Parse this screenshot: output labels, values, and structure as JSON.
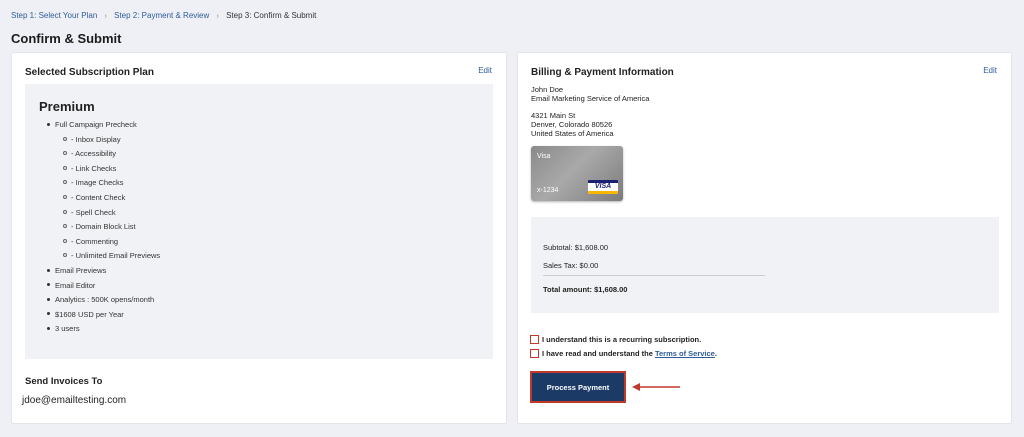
{
  "breadcrumb": {
    "steps": [
      "Step 1: Select Your Plan",
      "Step 2: Payment & Review",
      "Step 3: Confirm & Submit"
    ],
    "separator": "›"
  },
  "page_title": "Confirm & Submit",
  "subscription": {
    "title": "Selected Subscription Plan",
    "edit_label": "Edit",
    "plan_name": "Premium",
    "features": [
      "Full Campaign Precheck",
      "- Inbox Display",
      "- Accessibility",
      "- Link Checks",
      "- Image Checks",
      "- Content Check",
      "- Spell Check",
      "- Domain Block List",
      "- Commenting",
      "- Unlimited Email Previews",
      "Email Previews",
      "Email Editor",
      "Analytics : 500K opens/month",
      "$1608 USD per Year",
      "3 users"
    ]
  },
  "invoices": {
    "title": "Send Invoices To",
    "email": "jdoe@emailtesting.com"
  },
  "billing": {
    "title": "Billing & Payment Information",
    "edit_label": "Edit",
    "name": "John Doe",
    "company": "Email Marketing Service of America",
    "street": "4321 Main St",
    "city_state": "Denver, Colorado 80526",
    "country": "United States of America",
    "card_brand": "Visa",
    "card_number": "x-1234",
    "card_logo": "VISA"
  },
  "summary": {
    "subtotal": "Subtotal: $1,608.00",
    "sales_tax": "Sales Tax: $0.00",
    "total": "Total amount: $1,608.00"
  },
  "agreements": {
    "recurring": "I understand this is a recurring subscription.",
    "tos_prefix": "I have read and understand the ",
    "tos_link": "Terms of Service",
    "tos_suffix": "."
  },
  "actions": {
    "process_payment": "Process Payment"
  },
  "colors": {
    "accent": "#1b3a66",
    "highlight": "#c0392b",
    "link": "#2f5c99"
  }
}
